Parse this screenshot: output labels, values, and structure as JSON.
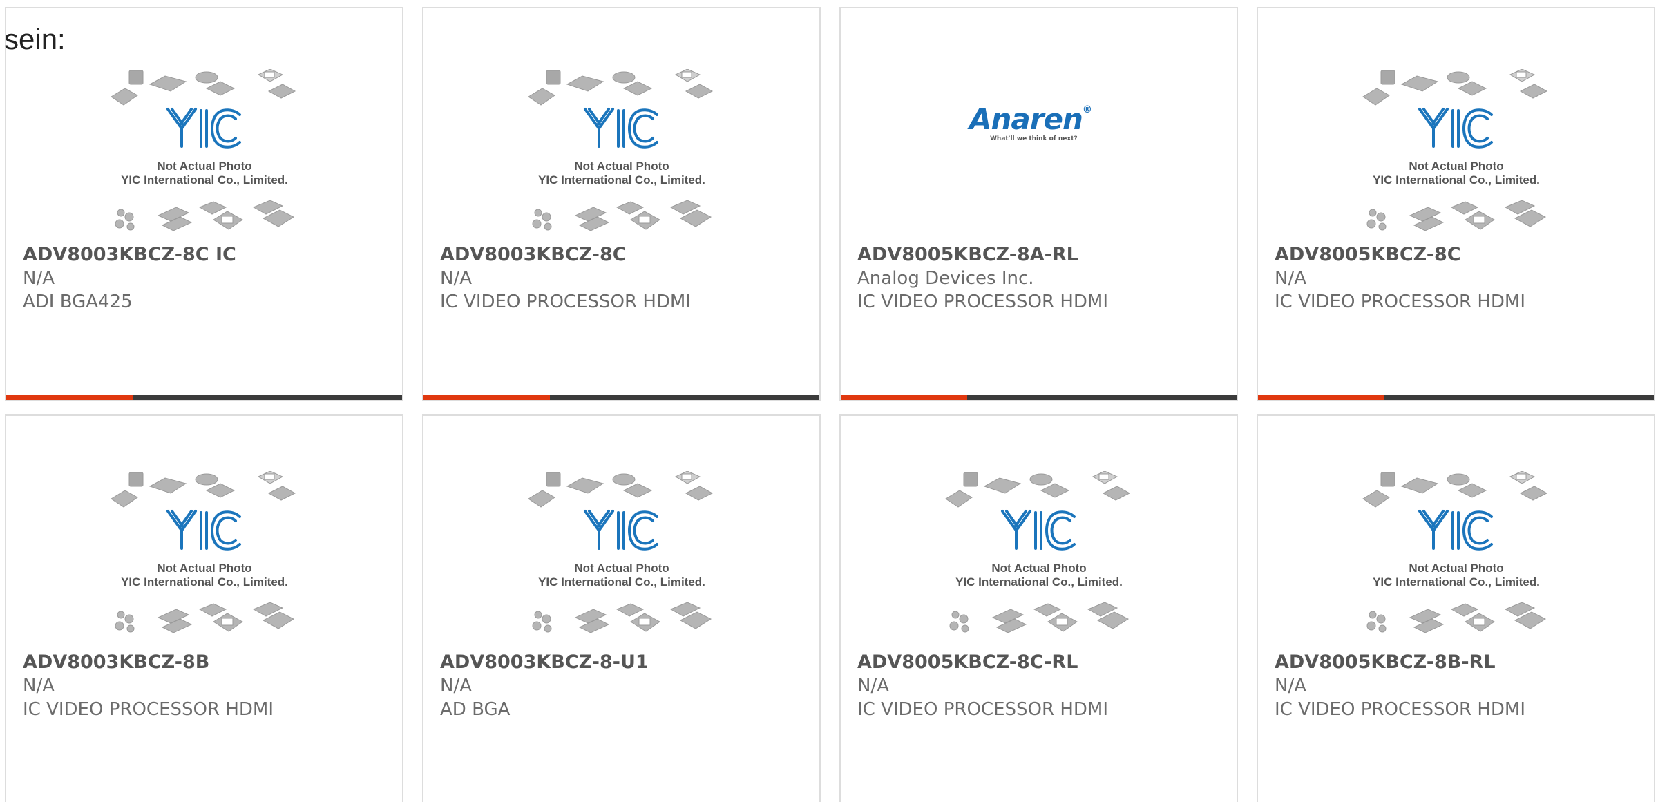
{
  "heading": "sein:",
  "placeholder_image": {
    "logo_text": "YIC",
    "caption_line1": "Not Actual Photo",
    "caption_line2": "YIC International Co., Limited."
  },
  "anaren_logo": {
    "name": "Anaren",
    "suffix": "®",
    "tagline": "What'll we think of next?"
  },
  "colors": {
    "accent_bar": "#e0380f",
    "bar_dark": "#3b3b3b",
    "yic_logo": "#1b75bc",
    "anaren_logo": "#1a6fb8"
  },
  "products": [
    {
      "part": "ADV8003KBCZ-8C IC",
      "manufacturer": "N/A",
      "description": "ADI BGA425",
      "image": "placeholder"
    },
    {
      "part": "ADV8003KBCZ-8C",
      "manufacturer": "N/A",
      "description": "IC VIDEO PROCESSOR HDMI",
      "image": "placeholder"
    },
    {
      "part": "ADV8005KBCZ-8A-RL",
      "manufacturer": "Analog Devices Inc.",
      "description": "IC VIDEO PROCESSOR HDMI",
      "image": "anaren-logo"
    },
    {
      "part": "ADV8005KBCZ-8C",
      "manufacturer": "N/A",
      "description": "IC VIDEO PROCESSOR HDMI",
      "image": "placeholder"
    },
    {
      "part": "ADV8003KBCZ-8B",
      "manufacturer": "N/A",
      "description": "IC VIDEO PROCESSOR HDMI",
      "image": "placeholder"
    },
    {
      "part": "ADV8003KBCZ-8-U1",
      "manufacturer": "N/A",
      "description": "AD BGA",
      "image": "placeholder"
    },
    {
      "part": "ADV8005KBCZ-8C-RL",
      "manufacturer": "N/A",
      "description": "IC VIDEO PROCESSOR HDMI",
      "image": "placeholder"
    },
    {
      "part": "ADV8005KBCZ-8B-RL",
      "manufacturer": "N/A",
      "description": "IC VIDEO PROCESSOR HDMI",
      "image": "placeholder"
    }
  ]
}
